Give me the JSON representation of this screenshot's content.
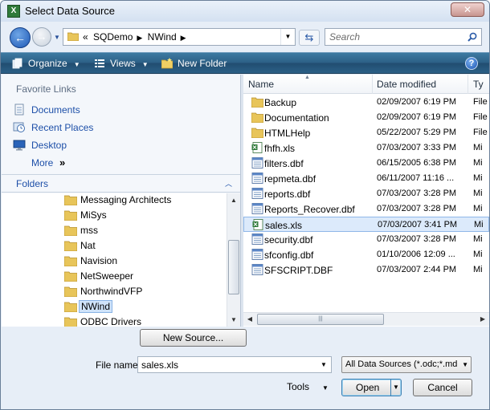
{
  "window": {
    "title": "Select Data Source"
  },
  "address": {
    "crumbs": [
      "SQDemo",
      "NWind"
    ],
    "overflow": "«"
  },
  "search": {
    "placeholder": "Search"
  },
  "toolbar": {
    "organize": "Organize",
    "views": "Views",
    "new_folder": "New Folder",
    "help": "?"
  },
  "favorites": {
    "header": "Favorite Links",
    "items": [
      {
        "label": "Documents",
        "icon": "documents-icon"
      },
      {
        "label": "Recent Places",
        "icon": "recent-places-icon"
      },
      {
        "label": "Desktop",
        "icon": "desktop-icon"
      },
      {
        "label": "More",
        "icon": "more-chevron-icon",
        "suffix": "»"
      }
    ]
  },
  "folders": {
    "label": "Folders",
    "items": [
      {
        "label": "Messaging Architects"
      },
      {
        "label": "MiSys"
      },
      {
        "label": "mss"
      },
      {
        "label": "Nat"
      },
      {
        "label": "Navision"
      },
      {
        "label": "NetSweeper"
      },
      {
        "label": "NorthwindVFP"
      },
      {
        "label": "NWind",
        "selected": true
      },
      {
        "label": "ODBC Drivers"
      }
    ]
  },
  "file_list": {
    "columns": {
      "name": "Name",
      "date": "Date modified",
      "type": "Ty"
    },
    "rows": [
      {
        "name": "Backup",
        "date": "02/09/2007 6:19 PM",
        "type": "File",
        "icon": "folder-icon"
      },
      {
        "name": "Documentation",
        "date": "02/09/2007 6:19 PM",
        "type": "File",
        "icon": "folder-icon"
      },
      {
        "name": "HTMLHelp",
        "date": "05/22/2007 5:29 PM",
        "type": "File",
        "icon": "folder-icon"
      },
      {
        "name": "fhfh.xls",
        "date": "07/03/2007 3:33 PM",
        "type": "Mi",
        "icon": "excel-file-icon"
      },
      {
        "name": "filters.dbf",
        "date": "06/15/2005 6:38 PM",
        "type": "Mi",
        "icon": "dbf-file-icon"
      },
      {
        "name": "repmeta.dbf",
        "date": "06/11/2007 11:16 ...",
        "type": "Mi",
        "icon": "dbf-file-icon"
      },
      {
        "name": "reports.dbf",
        "date": "07/03/2007 3:28 PM",
        "type": "Mi",
        "icon": "dbf-file-icon"
      },
      {
        "name": "Reports_Recover.dbf",
        "date": "07/03/2007 3:28 PM",
        "type": "Mi",
        "icon": "dbf-file-icon"
      },
      {
        "name": "sales.xls",
        "date": "07/03/2007 3:41 PM",
        "type": "Mi",
        "icon": "excel-file-icon",
        "selected": true
      },
      {
        "name": "security.dbf",
        "date": "07/03/2007 3:28 PM",
        "type": "Mi",
        "icon": "dbf-file-icon"
      },
      {
        "name": "sfconfig.dbf",
        "date": "01/10/2006 12:09 ...",
        "type": "Mi",
        "icon": "dbf-file-icon"
      },
      {
        "name": "SFSCRIPT.DBF",
        "date": "07/03/2007 2:44 PM",
        "type": "Mi",
        "icon": "dbf-file-icon"
      }
    ]
  },
  "bottom": {
    "new_source": "New Source...",
    "file_name_label": "File name:",
    "file_name_value": "sales.xls",
    "filter_value": "All Data Sources (*.odc;*.mdb",
    "tools": "Tools",
    "open": "Open",
    "cancel": "Cancel"
  },
  "colors": {
    "toolbar": "#2c5f86",
    "link": "#1d4fa8",
    "selection": "#dceafb"
  }
}
